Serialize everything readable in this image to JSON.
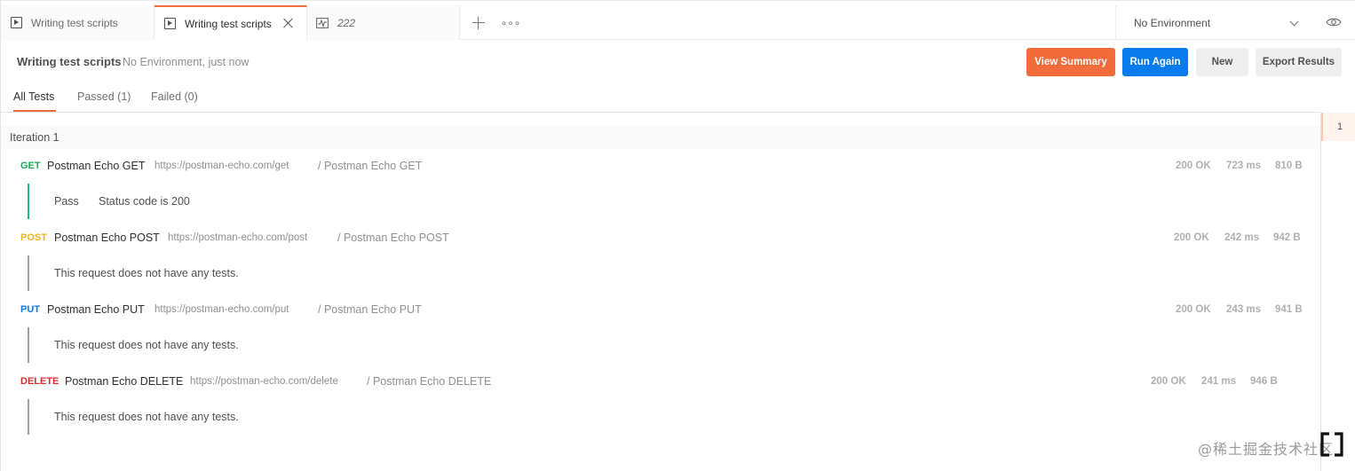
{
  "tabs": [
    {
      "label": "Writing test scripts",
      "active": false,
      "icon": "runner-icon"
    },
    {
      "label": "Writing test scripts",
      "active": true,
      "icon": "runner-icon"
    },
    {
      "label": "222",
      "active": false,
      "icon": "monitor-icon"
    }
  ],
  "environment": {
    "selected": "No Environment"
  },
  "run": {
    "title": "Writing test scripts",
    "meta": "No Environment, just now"
  },
  "actions": {
    "view_summary": "View Summary",
    "run_again": "Run Again",
    "new": "New",
    "export_results": "Export Results"
  },
  "filters": [
    {
      "label": "All Tests",
      "active": true
    },
    {
      "label": "Passed (1)",
      "active": false
    },
    {
      "label": "Failed (0)",
      "active": false
    }
  ],
  "iteration": {
    "label": "Iteration 1",
    "number": "1"
  },
  "requests": [
    {
      "method": "GET",
      "method_color": "#26a65b",
      "name": "Postman Echo GET",
      "url": "https://postman-echo.com/get",
      "path": "/ Postman Echo GET",
      "status": "200 OK",
      "time": "723 ms",
      "size": "810 B",
      "result": {
        "type": "pass",
        "label": "Pass",
        "text": "Status code is 200"
      }
    },
    {
      "method": "POST",
      "method_color": "#f0b429",
      "name": "Postman Echo POST",
      "url": "https://postman-echo.com/post",
      "path": "/ Postman Echo POST",
      "status": "200 OK",
      "time": "242 ms",
      "size": "942 B",
      "result": {
        "type": "none",
        "text": "This request does not have any tests."
      }
    },
    {
      "method": "PUT",
      "method_color": "#097bed",
      "name": "Postman Echo PUT",
      "url": "https://postman-echo.com/put",
      "path": "/ Postman Echo PUT",
      "status": "200 OK",
      "time": "243 ms",
      "size": "941 B",
      "result": {
        "type": "none",
        "text": "This request does not have any tests."
      }
    },
    {
      "method": "DELETE",
      "method_color": "#d0312d",
      "name": "Postman Echo DELETE",
      "url": "https://postman-echo.com/delete",
      "path": "/ Postman Echo DELETE",
      "status": "200 OK",
      "time": "241 ms",
      "size": "946 B",
      "result": {
        "type": "none",
        "text": "This request does not have any tests."
      }
    }
  ],
  "watermark": "@稀土掘金技术社区",
  "colors": {
    "accent": "#f26b3a",
    "primary": "#097bed",
    "pass": "#26b47f"
  }
}
